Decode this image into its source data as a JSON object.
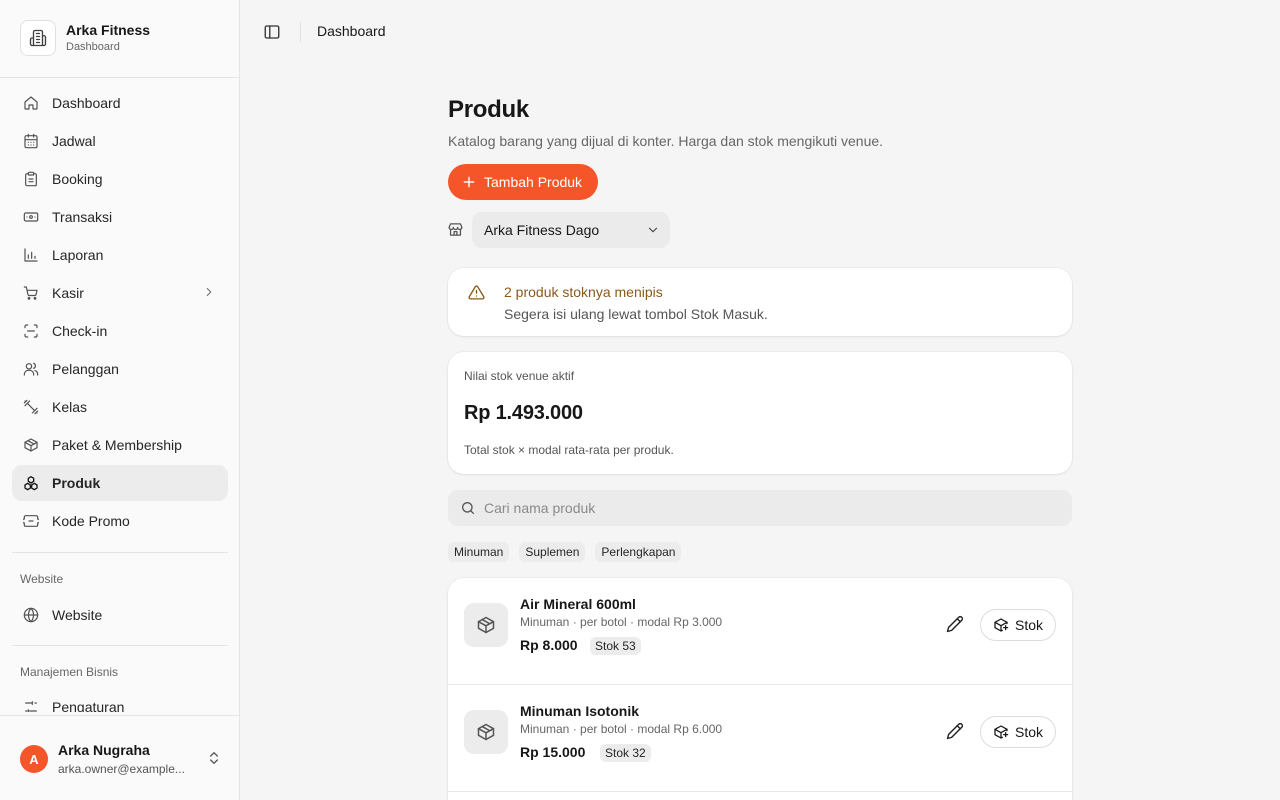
{
  "brand": {
    "name": "Arka Fitness",
    "subtitle": "Dashboard"
  },
  "sidebar": {
    "items": [
      {
        "label": "Dashboard",
        "icon": "home-icon"
      },
      {
        "label": "Jadwal",
        "icon": "calendar-icon"
      },
      {
        "label": "Booking",
        "icon": "clipboard-icon"
      },
      {
        "label": "Transaksi",
        "icon": "banknote-icon"
      },
      {
        "label": "Laporan",
        "icon": "bar-chart-icon"
      },
      {
        "label": "Kasir",
        "icon": "cart-icon"
      },
      {
        "label": "Check-in",
        "icon": "scan-icon"
      },
      {
        "label": "Pelanggan",
        "icon": "users-icon"
      },
      {
        "label": "Kelas",
        "icon": "dumbbell-icon"
      },
      {
        "label": "Paket & Membership",
        "icon": "package-icon"
      },
      {
        "label": "Produk",
        "icon": "products-icon",
        "active": true
      },
      {
        "label": "Kode Promo",
        "icon": "ticket-icon"
      }
    ],
    "website_section": "Website",
    "website_item": "Website",
    "business_section": "Manajemen Bisnis",
    "business_item": "Pengaturan"
  },
  "user": {
    "initial": "A",
    "name": "Arka Nugraha",
    "email": "arka.owner@example..."
  },
  "topbar": {
    "title": "Dashboard"
  },
  "page": {
    "title": "Produk",
    "description": "Katalog barang yang dijual di konter. Harga dan stok mengikuti venue.",
    "add_button": "Tambah Produk",
    "venue": "Arka Fitness Dago"
  },
  "alert": {
    "title": "2 produk stoknya menipis",
    "description": "Segera isi ulang lewat tombol Stok Masuk."
  },
  "stock_value": {
    "label": "Nilai stok venue aktif",
    "amount": "Rp 1.493.000",
    "note": "Total stok × modal rata-rata per produk."
  },
  "search": {
    "placeholder": "Cari nama produk"
  },
  "categories": [
    "Minuman",
    "Suplemen",
    "Perlengkapan"
  ],
  "products": [
    {
      "name": "Air Mineral 600ml",
      "meta": "Minuman · per botol · modal Rp 3.000",
      "price": "Rp 8.000",
      "stock": "Stok 53",
      "stock_button": "Stok"
    },
    {
      "name": "Minuman Isotonik",
      "meta": "Minuman · per botol · modal Rp 6.000",
      "price": "Rp 15.000",
      "stock": "Stok 32",
      "stock_button": "Stok"
    }
  ],
  "colors": {
    "accent": "#f4562a",
    "warning_text": "#8a5a1b"
  }
}
